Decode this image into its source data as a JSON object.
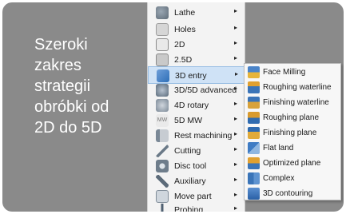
{
  "caption": [
    "Szeroki",
    "zakres",
    "strategii",
    "obróbki od",
    "2D do 5D"
  ],
  "menu": [
    {
      "label": "Lathe",
      "icon": "lathe-icon",
      "submenu": true
    },
    {
      "label": "Holes",
      "icon": "holes-icon",
      "submenu": true
    },
    {
      "label": "2D",
      "icon": "2d-icon",
      "submenu": true
    },
    {
      "label": "2.5D",
      "icon": "2-5d-icon",
      "submenu": true
    },
    {
      "label": "3D entry",
      "icon": "3d-entry-icon",
      "submenu": true,
      "selected": true
    },
    {
      "label": "3D/5D advanced",
      "icon": "3d-5d-advanced-icon",
      "submenu": true
    },
    {
      "label": "4D rotary",
      "icon": "4d-rotary-icon",
      "submenu": true
    },
    {
      "label": "5D MW",
      "icon": "5d-mw-icon",
      "icon_text": "MW",
      "submenu": true
    },
    {
      "label": "Rest machining",
      "icon": "rest-machining-icon",
      "submenu": true
    },
    {
      "label": "Cutting",
      "icon": "cutting-icon",
      "submenu": true
    },
    {
      "label": "Disc tool",
      "icon": "disc-tool-icon",
      "submenu": true
    },
    {
      "label": "Auxiliary",
      "icon": "auxiliary-icon",
      "submenu": true
    },
    {
      "label": "Move part",
      "icon": "move-part-icon",
      "submenu": true
    },
    {
      "label": "Probing",
      "icon": "probing-icon",
      "submenu": true
    }
  ],
  "submenu": [
    {
      "label": "Face Milling",
      "icon": "face-milling-icon"
    },
    {
      "label": "Roughing waterline",
      "icon": "roughing-waterline-icon"
    },
    {
      "label": "Finishing waterline",
      "icon": "finishing-waterline-icon"
    },
    {
      "label": "Roughing plane",
      "icon": "roughing-plane-icon"
    },
    {
      "label": "Finishing plane",
      "icon": "finishing-plane-icon"
    },
    {
      "label": "Flat land",
      "icon": "flat-land-icon"
    },
    {
      "label": "Optimized plane",
      "icon": "optimized-plane-icon"
    },
    {
      "label": "Complex",
      "icon": "complex-icon"
    },
    {
      "label": "3D contouring",
      "icon": "3d-contouring-icon"
    }
  ],
  "submenu_arrow": "▸"
}
